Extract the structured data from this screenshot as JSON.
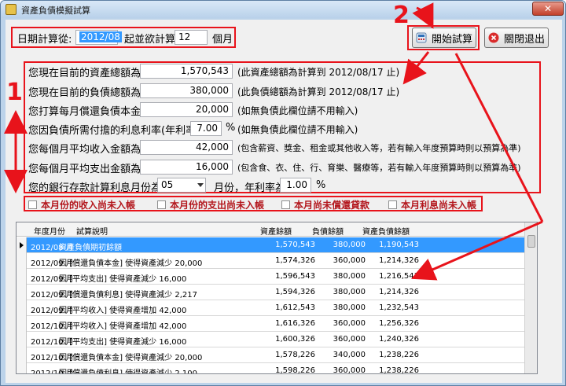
{
  "window": {
    "title": "資產負債模擬試算",
    "close_glyph": "✕"
  },
  "header": {
    "date_from_label": "日期計算從:",
    "date_from_value": "2012/08",
    "months_label": "起並欲計算",
    "months_value": "12",
    "months_unit": "個月",
    "start_button": "開始試算",
    "exit_button": "關閉退出"
  },
  "form": {
    "rows": [
      {
        "label": "您現在目前的資產總額為:",
        "value": "1,570,543",
        "note": "(此資產總額為計算到 2012/08/17 止)"
      },
      {
        "label": "您現在目前的負債總額為:",
        "value": "380,000",
        "note": "(此負債總額為計算到 2012/08/17 止)"
      },
      {
        "label": "您打算每月償還負債本金:",
        "value": "20,000",
        "note": "(如無負債此欄位請不用輸入)"
      },
      {
        "label": "您因負債所需付擔的利息利率(年利率):",
        "value": "7.00",
        "unit": "%",
        "note": "(如無負債此欄位請不用輸入)"
      },
      {
        "label": "您每個月平均收入金額為:",
        "value": "42,000",
        "note": "(包含薪資、獎金、租金或其他收入等，若有輸入年度預算時則以預算為準)"
      },
      {
        "label": "您每個月平均支出金額為:",
        "value": "16,000",
        "note": "(包含食、衣、住、行、育樂、醫療等，若有輸入年度預算時則以預算為準)"
      }
    ],
    "bank": {
      "label": "您的銀行存款計算利息月份為:",
      "month_value": "05",
      "month_unit": "月份，年利率為",
      "rate_value": "1.00",
      "rate_unit": "%"
    }
  },
  "checkboxes": [
    "本月份的收入尚未入帳",
    "本月份的支出尚未入帳",
    "本月尚未償還貸款",
    "本月利息尚未入帳"
  ],
  "table": {
    "headers": [
      "年度月份",
      "試算說明",
      "資產餘額",
      "負債餘額",
      "資產負債餘額"
    ],
    "rows": [
      [
        "2012/08 月",
        "資產負債期初餘額",
        "1,570,543",
        "380,000",
        "1,190,543"
      ],
      [
        "2012/09 月",
        "因 [償還負債本金] 使得資產減少 20,000",
        "1,574,326",
        "360,000",
        "1,214,326"
      ],
      [
        "2012/09 月",
        "因 [平均支出] 使得資產減少 16,000",
        "1,596,543",
        "380,000",
        "1,216,543"
      ],
      [
        "2012/09 月",
        "因 [償還負債利息] 使得資產減少 2,217",
        "1,594,326",
        "380,000",
        "1,214,326"
      ],
      [
        "2012/09 月",
        "因 [平均收入] 使得資產增加 42,000",
        "1,612,543",
        "380,000",
        "1,232,543"
      ],
      [
        "2012/10 月",
        "因 [平均收入] 使得資產增加 42,000",
        "1,616,326",
        "360,000",
        "1,256,326"
      ],
      [
        "2012/10 月",
        "因 [平均支出] 使得資產減少 16,000",
        "1,600,326",
        "360,000",
        "1,240,326"
      ],
      [
        "2012/10 月",
        "因 [償還負債本金] 使得資產減少 20,000",
        "1,578,226",
        "340,000",
        "1,238,226"
      ],
      [
        "2012/10 月",
        "因 [償還負債利息] 使得資產減少 2,100",
        "1,598,226",
        "360,000",
        "1,238,226"
      ]
    ]
  },
  "annotations": {
    "step1": "1",
    "step2": "2"
  },
  "colors": {
    "annotation_red": "#e8131b",
    "selection_blue": "#3399ff",
    "checkbox_red": "#b3161c"
  }
}
